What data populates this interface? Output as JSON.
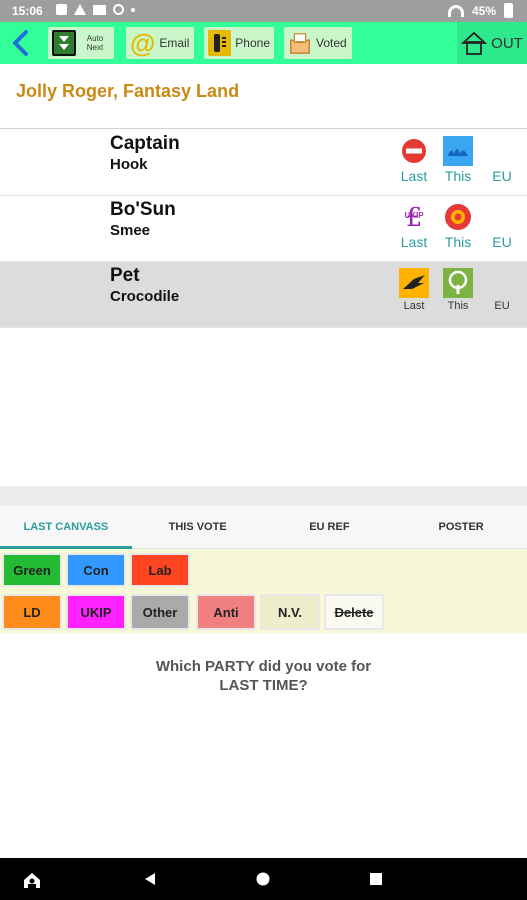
{
  "status_bar": {
    "time": "15:06",
    "battery": "45%"
  },
  "colors": {
    "toolbar": "#33ff99",
    "accent": "#2a9d9d",
    "address": "#c98a16",
    "panel_bg": "#f8f7d8"
  },
  "toolbar": {
    "back_icon": "arrow-back-icon",
    "auto_next_label": "Auto Next",
    "email_label": "Email",
    "phone_label": "Phone",
    "voted_label": "Voted",
    "out_label": "OUT"
  },
  "address": "Jolly Roger, Fantasy Land",
  "voters": [
    {
      "title": "Captain",
      "name": "Hook",
      "last": "Last",
      "this": "This",
      "eu": "EU",
      "last_icon": "no-entry-icon",
      "this_icon": "grass-icon"
    },
    {
      "title": "Bo'Sun",
      "name": "Smee",
      "last": "Last",
      "this": "This",
      "eu": "EU",
      "last_icon": "ukip-pound-icon",
      "this_icon": "rose-icon"
    },
    {
      "title": "Pet",
      "name": "Crocodile",
      "last": "Last",
      "this": "This",
      "eu": "EU",
      "last_icon": "libdem-bird-icon",
      "this_icon": "green-tree-icon"
    }
  ],
  "tabs": [
    "LAST CANVASS",
    "THIS VOTE",
    "EU REF",
    "POSTER"
  ],
  "parties": {
    "row1": [
      {
        "label": "Green",
        "color": "#22bb33"
      },
      {
        "label": "Con",
        "color": "#3399ff"
      },
      {
        "label": "Lab",
        "color": "#ff4422"
      }
    ],
    "row2": [
      {
        "label": "LD",
        "color": "#ff8c1a"
      },
      {
        "label": "UKIP",
        "color": "#ff22ff"
      },
      {
        "label": "Other",
        "color": "#aaaaaa"
      },
      {
        "label": "Anti",
        "color": "#f08080"
      },
      {
        "label": "N.V.",
        "color": "#eeeecc"
      },
      {
        "label": "Delete",
        "color": "#fafaf0"
      }
    ]
  },
  "question": {
    "line1": "Which PARTY did you vote for",
    "line2": "LAST TIME?"
  }
}
